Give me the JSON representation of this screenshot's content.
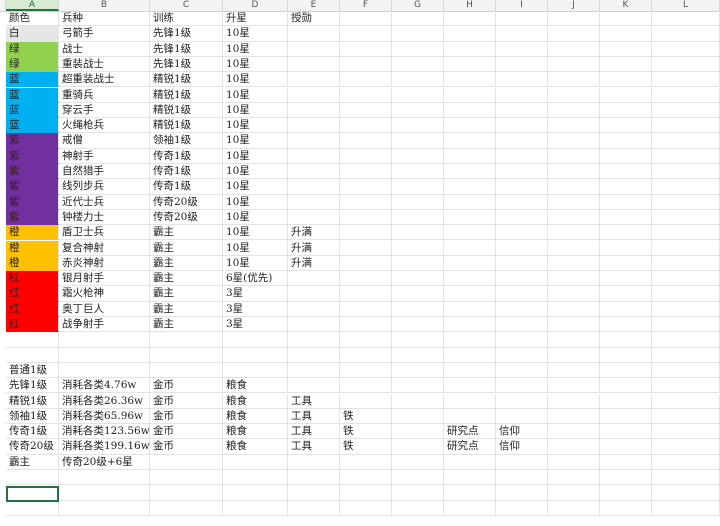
{
  "column_headers": [
    "A",
    "B",
    "C",
    "D",
    "E",
    "F",
    "G",
    "H",
    "I",
    "J",
    "K",
    "L"
  ],
  "row_count": 33,
  "rows": [
    {
      "A": "颜色",
      "B": "兵种",
      "C": "训练",
      "D": "升星",
      "E": "授勋"
    },
    {
      "A": "白",
      "B": "弓箭手",
      "C": "先锋1级",
      "D": "10星",
      "fill": "#e6e6e6"
    },
    {
      "A": "绿",
      "B": "战士",
      "C": "先锋1级",
      "D": "10星",
      "fill": "#92d050"
    },
    {
      "A": "绿",
      "B": "重装战士",
      "C": "先锋1级",
      "D": "10星",
      "fill": "#92d050"
    },
    {
      "A": "蓝",
      "B": "超重装战士",
      "C": "精锐1级",
      "D": "10星",
      "fill": "#00b0f0"
    },
    {
      "A": "蓝",
      "B": "重骑兵",
      "C": "精锐1级",
      "D": "10星",
      "fill": "#00b0f0"
    },
    {
      "A": "蓝",
      "B": "穿云手",
      "C": "精锐1级",
      "D": "10星",
      "fill": "#00b0f0"
    },
    {
      "A": "蓝",
      "B": "火绳枪兵",
      "C": "精锐1级",
      "D": "10星",
      "fill": "#00b0f0"
    },
    {
      "A": "紫",
      "B": "戒僧",
      "C": "领袖1级",
      "D": "10星",
      "fill": "#7030a0"
    },
    {
      "A": "紫",
      "B": "神射手",
      "C": "传奇1级",
      "D": "10星",
      "fill": "#7030a0"
    },
    {
      "A": "紫",
      "B": "自然猎手",
      "C": "传奇1级",
      "D": "10星",
      "fill": "#7030a0"
    },
    {
      "A": "紫",
      "B": "线列步兵",
      "C": "传奇1级",
      "D": "10星",
      "fill": "#7030a0"
    },
    {
      "A": "紫",
      "B": "近代士兵",
      "C": "传奇20级",
      "D": "10星",
      "fill": "#7030a0"
    },
    {
      "A": "紫",
      "B": "钟楼力士",
      "C": "传奇20级",
      "D": "10星",
      "fill": "#7030a0"
    },
    {
      "A": "橙",
      "B": "盾卫士兵",
      "C": "霸主",
      "D": "10星",
      "E": "升满",
      "fill": "#ffc000"
    },
    {
      "A": "橙",
      "B": "复合神射",
      "C": "霸主",
      "D": "10星",
      "E": "升满",
      "fill": "#ffc000"
    },
    {
      "A": "橙",
      "B": "赤炎神射",
      "C": "霸主",
      "D": "10星",
      "E": "升满",
      "fill": "#ffc000"
    },
    {
      "A": "红",
      "B": "银月射手",
      "C": "霸主",
      "D": "6星(优先)",
      "fill": "#ff0000"
    },
    {
      "A": "红",
      "B": "霜火枪神",
      "C": "霸主",
      "D": "3星",
      "fill": "#ff0000"
    },
    {
      "A": "红",
      "B": "奥丁巨人",
      "C": "霸主",
      "D": "3星",
      "fill": "#ff0000"
    },
    {
      "A": "红",
      "B": "战争射手",
      "C": "霸主",
      "D": "3星",
      "fill": "#ff0000"
    },
    {},
    {},
    {
      "A": "普通1级"
    },
    {
      "A": "先锋1级",
      "B": "消耗各类4.76w",
      "C": "金币",
      "D": "粮食"
    },
    {
      "A": "精锐1级",
      "B": "消耗各类26.36w",
      "C": "金币",
      "D": "粮食",
      "E": "工具"
    },
    {
      "A": "领袖1级",
      "B": "消耗各类65.96w",
      "C": "金币",
      "D": "粮食",
      "E": "工具",
      "F": "铁"
    },
    {
      "A": "传奇1级",
      "B": "消耗各类123.56w",
      "C": "金币",
      "D": "粮食",
      "E": "工具",
      "F": "铁",
      "H": "研究点",
      "I": "信仰"
    },
    {
      "A": "传奇20级",
      "B": "消耗各类199.16w",
      "C": "金币",
      "D": "粮食",
      "E": "工具",
      "F": "铁",
      "H": "研究点",
      "I": "信仰"
    },
    {
      "A": "霸主",
      "B": "传奇20级+6星"
    },
    {},
    {},
    {}
  ]
}
